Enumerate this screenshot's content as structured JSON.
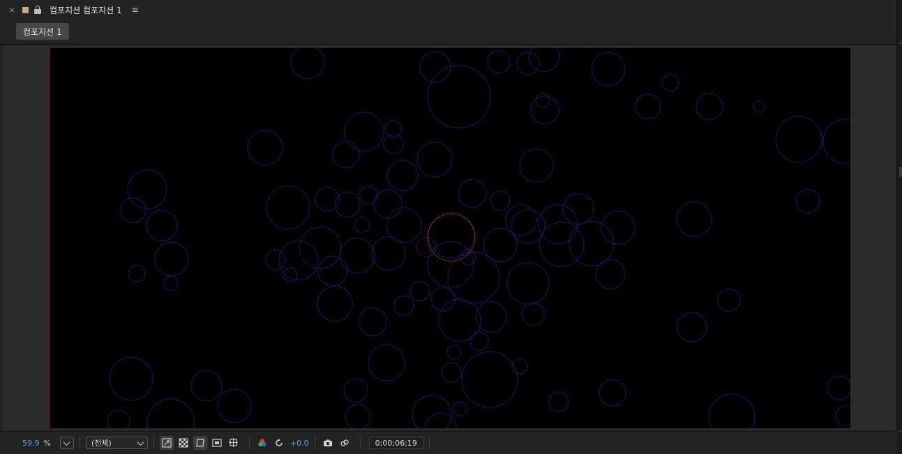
{
  "header": {
    "close_label": "×",
    "title": "컴포지션 컴포지션 1",
    "menu_label": "≡",
    "swatch_color": "#c4aa8c"
  },
  "tabs": [
    {
      "label": "컴포지션 1",
      "active": true
    }
  ],
  "toolbar": {
    "zoom_value": "59.9",
    "zoom_unit": "%",
    "resolution": "(전체)",
    "exposure": "+0.0",
    "timecode": "0;00;06;19",
    "accent_color": "#5b9cf0"
  },
  "viewer": {
    "background_color": "#000000",
    "circle_color": "#2a1f9c",
    "selected_circle_color": "#c8502a"
  }
}
